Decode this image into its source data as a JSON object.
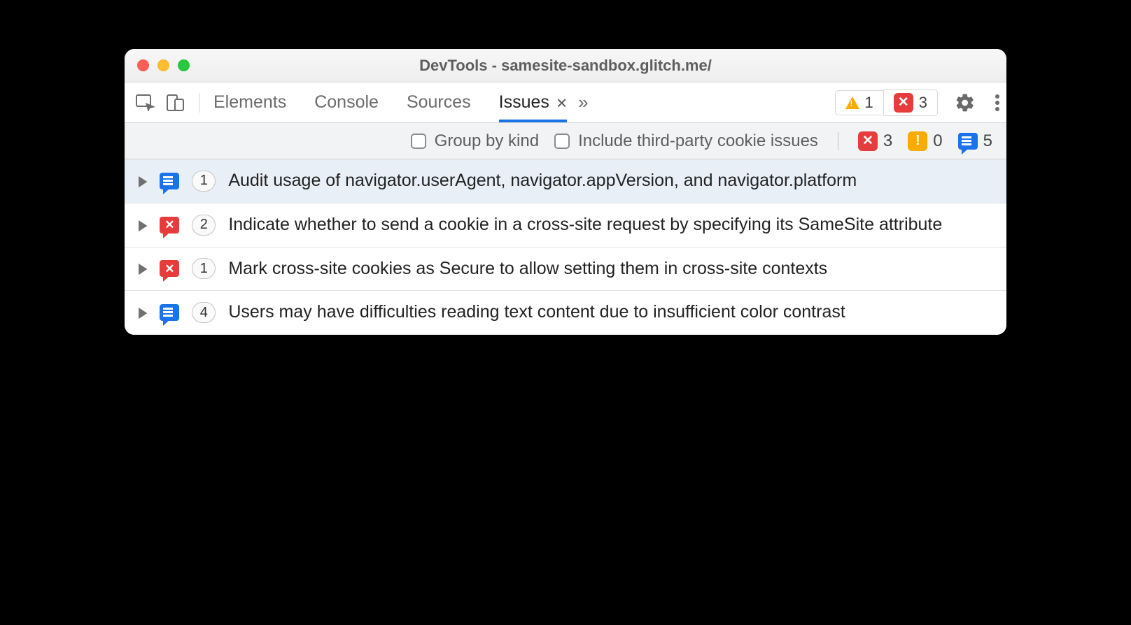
{
  "window_title": "DevTools - samesite-sandbox.glitch.me/",
  "tabs": {
    "elements": "Elements",
    "console": "Console",
    "sources": "Sources",
    "issues": "Issues"
  },
  "toolbar_badges": {
    "warning_count": "1",
    "error_count": "3"
  },
  "filterbar": {
    "group_by_kind": "Group by kind",
    "include_third_party": "Include third-party cookie issues",
    "counts": {
      "errors": "3",
      "warnings": "0",
      "info": "5"
    }
  },
  "issues": [
    {
      "icon": "chat-blue",
      "count": "1",
      "title": "Audit usage of navigator.userAgent, navigator.appVersion, and navigator.platform",
      "selected": true
    },
    {
      "icon": "chat-red",
      "count": "2",
      "title": "Indicate whether to send a cookie in a cross-site request by specifying its SameSite attribute",
      "selected": false
    },
    {
      "icon": "chat-red",
      "count": "1",
      "title": "Mark cross-site cookies as Secure to allow setting them in cross-site contexts",
      "selected": false
    },
    {
      "icon": "chat-blue",
      "count": "4",
      "title": "Users may have difficulties reading text content due to insufficient color contrast",
      "selected": false
    }
  ]
}
